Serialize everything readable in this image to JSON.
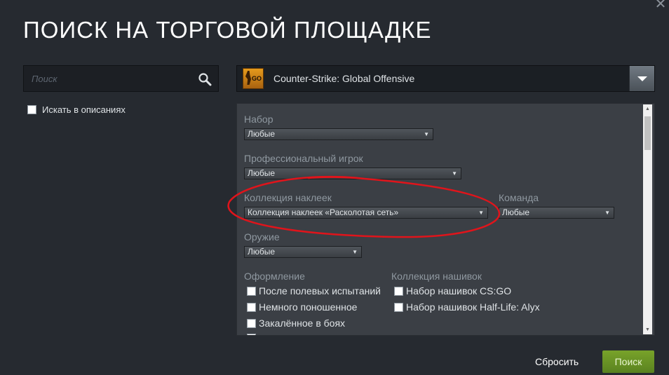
{
  "dialog": {
    "title": "ПОИСК НА ТОРГОВОЙ ПЛОЩАДКЕ",
    "close_icon": "close-icon"
  },
  "search": {
    "placeholder": "Поиск",
    "value": "",
    "icon": "search-icon",
    "search_descriptions_label": "Искать в описаниях",
    "search_descriptions_checked": false
  },
  "game_select": {
    "icon": "csgo-game-icon",
    "icon_text": "GO",
    "selected": "Counter-Strike: Global Offensive"
  },
  "filters": {
    "set": {
      "label": "Набор",
      "value": "Любые"
    },
    "pro_player": {
      "label": "Профессиональный игрок",
      "value": "Любые"
    },
    "sticker_collection": {
      "label": "Коллекция наклеек",
      "value": "Коллекция наклеек «Расколотая сеть»"
    },
    "team": {
      "label": "Команда",
      "value": "Любые"
    },
    "weapon": {
      "label": "Оружие",
      "value": "Любые"
    },
    "exterior": {
      "label": "Оформление",
      "options": [
        {
          "label": "После полевых испытаний",
          "checked": false
        },
        {
          "label": "Немного поношенное",
          "checked": false
        },
        {
          "label": "Закалённое в боях",
          "checked": false
        }
      ]
    },
    "patch_collection": {
      "label": "Коллекция нашивок",
      "options": [
        {
          "label": "Набор нашивок CS:GO",
          "checked": false
        },
        {
          "label": "Набор нашивок Half-Life: Alyx",
          "checked": false
        }
      ]
    }
  },
  "annotation": {
    "color": "#e0141b",
    "shape": "hand-drawn red ellipse around sticker collection filter"
  },
  "buttons": {
    "reset": "Сбросить",
    "search": "Поиск"
  },
  "colors": {
    "accent_green": "#6b9a24",
    "background": "#262a30",
    "panel": "#3b3f45"
  }
}
